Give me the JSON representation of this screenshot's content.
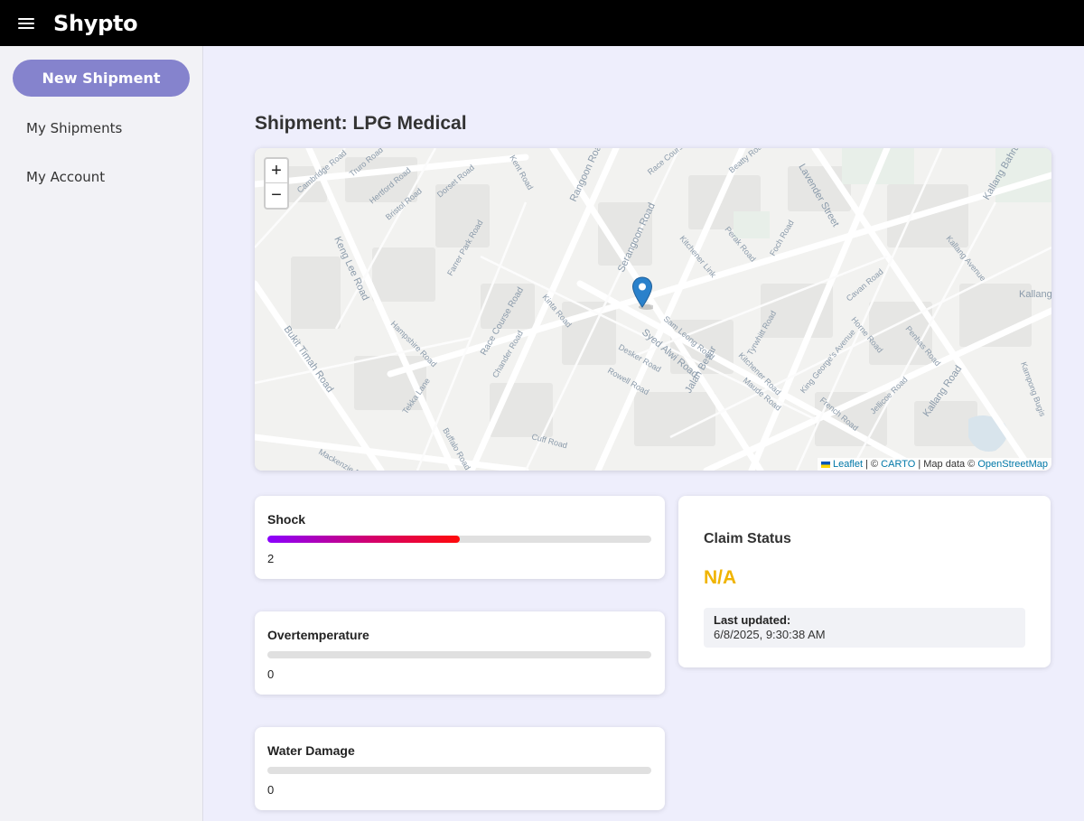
{
  "app": {
    "title": "Shypto",
    "menu_icon": "hamburger-menu-icon"
  },
  "sidebar": {
    "new_shipment_label": "New Shipment",
    "items": [
      {
        "label": "My Shipments"
      },
      {
        "label": "My Account"
      }
    ]
  },
  "shipment": {
    "title": "Shipment: LPG Medical"
  },
  "map": {
    "zoom_in": "+",
    "zoom_out": "−",
    "attribution": {
      "leaflet": "Leaflet",
      "sep1": " | © ",
      "carto": "CARTO",
      "sep2": " | Map data © ",
      "osm": "OpenStreetMap"
    },
    "marker_icon": "map-pin-icon",
    "marker_color": "#2a81cb",
    "street_labels": [
      "Cambridge Road",
      "Truro Road",
      "Hertford Road",
      "Bristol Road",
      "Dorset Road",
      "Rangoon Road",
      "Race Course Lane",
      "Serangoon Road",
      "Beatty Road",
      "Lavender Street",
      "Kallang Bahru",
      "Kent Road",
      "Keng Lee Road",
      "Farrer Park Road",
      "Kitchener Link",
      "Perak Road",
      "Foch Road",
      "Kallang Avenue",
      "Kallang",
      "Hampshire Road",
      "Kinta Road",
      "Race Course Road",
      "Syed Alwi Road",
      "Sam Leong Road",
      "Tyrwhitt Road",
      "Cavan Road",
      "Bukit Timah Road",
      "Chander Road",
      "Desker Road",
      "Jalan Besar",
      "Kitchener Road",
      "King George's Avenue",
      "Horne Road",
      "Penhas Road",
      "Tekka Lane",
      "Rowell Road",
      "Maude Road",
      "French Road",
      "Jellicoe Road",
      "Kallang Road",
      "Kampong Bugis",
      "Buffalo Road",
      "Cuff Road",
      "Mackenzie Road"
    ]
  },
  "metrics": [
    {
      "label": "Shock",
      "value": "2",
      "level": 0.5
    },
    {
      "label": "Overtemperature",
      "value": "0",
      "level": 0
    },
    {
      "label": "Water Damage",
      "value": "0",
      "level": 0
    }
  ],
  "claim": {
    "title": "Claim Status",
    "status": "N/A",
    "status_color": "#f0b400",
    "last_updated_label": "Last updated:",
    "last_updated_value": "6/8/2025, 9:30:38 AM"
  },
  "colors": {
    "accent": "#8583cd",
    "topbar": "#000000",
    "background": "#eeeefc"
  }
}
